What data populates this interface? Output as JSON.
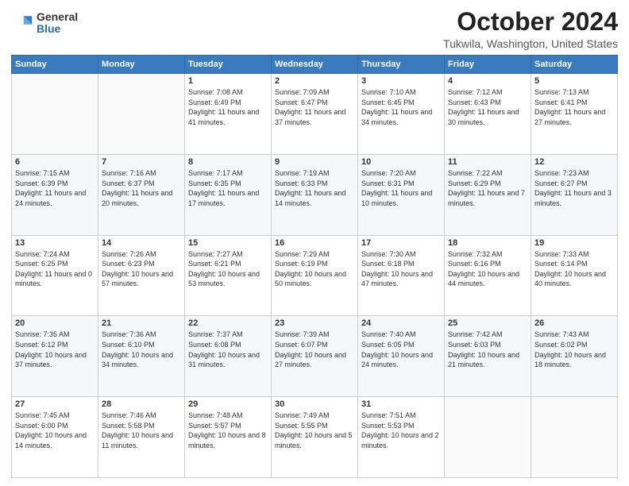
{
  "logo": {
    "general": "General",
    "blue": "Blue"
  },
  "title": {
    "month_year": "October 2024",
    "location": "Tukwila, Washington, United States"
  },
  "headers": [
    "Sunday",
    "Monday",
    "Tuesday",
    "Wednesday",
    "Thursday",
    "Friday",
    "Saturday"
  ],
  "weeks": [
    [
      {
        "day": "",
        "info": ""
      },
      {
        "day": "",
        "info": ""
      },
      {
        "day": "1",
        "info": "Sunrise: 7:08 AM\nSunset: 6:49 PM\nDaylight: 11 hours and 41 minutes."
      },
      {
        "day": "2",
        "info": "Sunrise: 7:09 AM\nSunset: 6:47 PM\nDaylight: 11 hours and 37 minutes."
      },
      {
        "day": "3",
        "info": "Sunrise: 7:10 AM\nSunset: 6:45 PM\nDaylight: 11 hours and 34 minutes."
      },
      {
        "day": "4",
        "info": "Sunrise: 7:12 AM\nSunset: 6:43 PM\nDaylight: 11 hours and 30 minutes."
      },
      {
        "day": "5",
        "info": "Sunrise: 7:13 AM\nSunset: 6:41 PM\nDaylight: 11 hours and 27 minutes."
      }
    ],
    [
      {
        "day": "6",
        "info": "Sunrise: 7:15 AM\nSunset: 6:39 PM\nDaylight: 11 hours and 24 minutes."
      },
      {
        "day": "7",
        "info": "Sunrise: 7:16 AM\nSunset: 6:37 PM\nDaylight: 11 hours and 20 minutes."
      },
      {
        "day": "8",
        "info": "Sunrise: 7:17 AM\nSunset: 6:35 PM\nDaylight: 11 hours and 17 minutes."
      },
      {
        "day": "9",
        "info": "Sunrise: 7:19 AM\nSunset: 6:33 PM\nDaylight: 11 hours and 14 minutes."
      },
      {
        "day": "10",
        "info": "Sunrise: 7:20 AM\nSunset: 6:31 PM\nDaylight: 11 hours and 10 minutes."
      },
      {
        "day": "11",
        "info": "Sunrise: 7:22 AM\nSunset: 6:29 PM\nDaylight: 11 hours and 7 minutes."
      },
      {
        "day": "12",
        "info": "Sunrise: 7:23 AM\nSunset: 6:27 PM\nDaylight: 11 hours and 3 minutes."
      }
    ],
    [
      {
        "day": "13",
        "info": "Sunrise: 7:24 AM\nSunset: 6:25 PM\nDaylight: 11 hours and 0 minutes."
      },
      {
        "day": "14",
        "info": "Sunrise: 7:26 AM\nSunset: 6:23 PM\nDaylight: 10 hours and 57 minutes."
      },
      {
        "day": "15",
        "info": "Sunrise: 7:27 AM\nSunset: 6:21 PM\nDaylight: 10 hours and 53 minutes."
      },
      {
        "day": "16",
        "info": "Sunrise: 7:29 AM\nSunset: 6:19 PM\nDaylight: 10 hours and 50 minutes."
      },
      {
        "day": "17",
        "info": "Sunrise: 7:30 AM\nSunset: 6:18 PM\nDaylight: 10 hours and 47 minutes."
      },
      {
        "day": "18",
        "info": "Sunrise: 7:32 AM\nSunset: 6:16 PM\nDaylight: 10 hours and 44 minutes."
      },
      {
        "day": "19",
        "info": "Sunrise: 7:33 AM\nSunset: 6:14 PM\nDaylight: 10 hours and 40 minutes."
      }
    ],
    [
      {
        "day": "20",
        "info": "Sunrise: 7:35 AM\nSunset: 6:12 PM\nDaylight: 10 hours and 37 minutes."
      },
      {
        "day": "21",
        "info": "Sunrise: 7:36 AM\nSunset: 6:10 PM\nDaylight: 10 hours and 34 minutes."
      },
      {
        "day": "22",
        "info": "Sunrise: 7:37 AM\nSunset: 6:08 PM\nDaylight: 10 hours and 31 minutes."
      },
      {
        "day": "23",
        "info": "Sunrise: 7:39 AM\nSunset: 6:07 PM\nDaylight: 10 hours and 27 minutes."
      },
      {
        "day": "24",
        "info": "Sunrise: 7:40 AM\nSunset: 6:05 PM\nDaylight: 10 hours and 24 minutes."
      },
      {
        "day": "25",
        "info": "Sunrise: 7:42 AM\nSunset: 6:03 PM\nDaylight: 10 hours and 21 minutes."
      },
      {
        "day": "26",
        "info": "Sunrise: 7:43 AM\nSunset: 6:02 PM\nDaylight: 10 hours and 18 minutes."
      }
    ],
    [
      {
        "day": "27",
        "info": "Sunrise: 7:45 AM\nSunset: 6:00 PM\nDaylight: 10 hours and 14 minutes."
      },
      {
        "day": "28",
        "info": "Sunrise: 7:46 AM\nSunset: 5:58 PM\nDaylight: 10 hours and 11 minutes."
      },
      {
        "day": "29",
        "info": "Sunrise: 7:48 AM\nSunset: 5:57 PM\nDaylight: 10 hours and 8 minutes."
      },
      {
        "day": "30",
        "info": "Sunrise: 7:49 AM\nSunset: 5:55 PM\nDaylight: 10 hours and 5 minutes."
      },
      {
        "day": "31",
        "info": "Sunrise: 7:51 AM\nSunset: 5:53 PM\nDaylight: 10 hours and 2 minutes."
      },
      {
        "day": "",
        "info": ""
      },
      {
        "day": "",
        "info": ""
      }
    ]
  ]
}
